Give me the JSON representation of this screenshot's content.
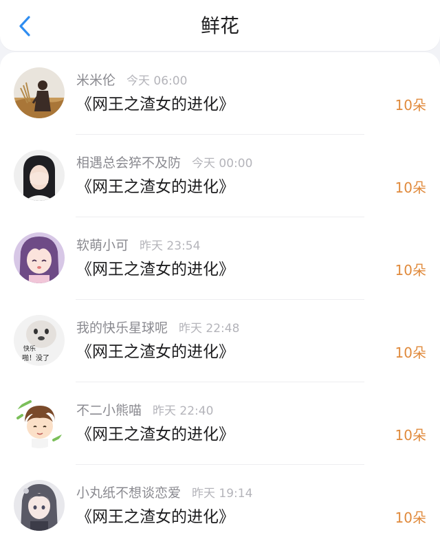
{
  "header": {
    "title": "鲜花",
    "back_icon": "chevron-left-icon",
    "accent_color": "#2f8df0"
  },
  "amount_color": "#e08a3c",
  "items": [
    {
      "name": "米米伦",
      "time": "今天 06:00",
      "book": "《网王之渣女的进化》",
      "amount": "10朵"
    },
    {
      "name": "相遇总会猝不及防",
      "time": "今天 00:00",
      "book": "《网王之渣女的进化》",
      "amount": "10朵"
    },
    {
      "name": "软萌小可",
      "time": "昨天 23:54",
      "book": "《网王之渣女的进化》",
      "amount": "10朵"
    },
    {
      "name": "我的快乐星球呢",
      "time": "昨天 22:48",
      "book": "《网王之渣女的进化》",
      "amount": "10朵",
      "avatar_text": [
        "快乐",
        "啪！没了"
      ]
    },
    {
      "name": "不二小熊喵",
      "time": "昨天 22:40",
      "book": "《网王之渣女的进化》",
      "amount": "10朵"
    },
    {
      "name": "小丸纸不想谈恋爱",
      "time": "昨天 19:14",
      "book": "《网王之渣女的进化》",
      "amount": "10朵"
    }
  ]
}
